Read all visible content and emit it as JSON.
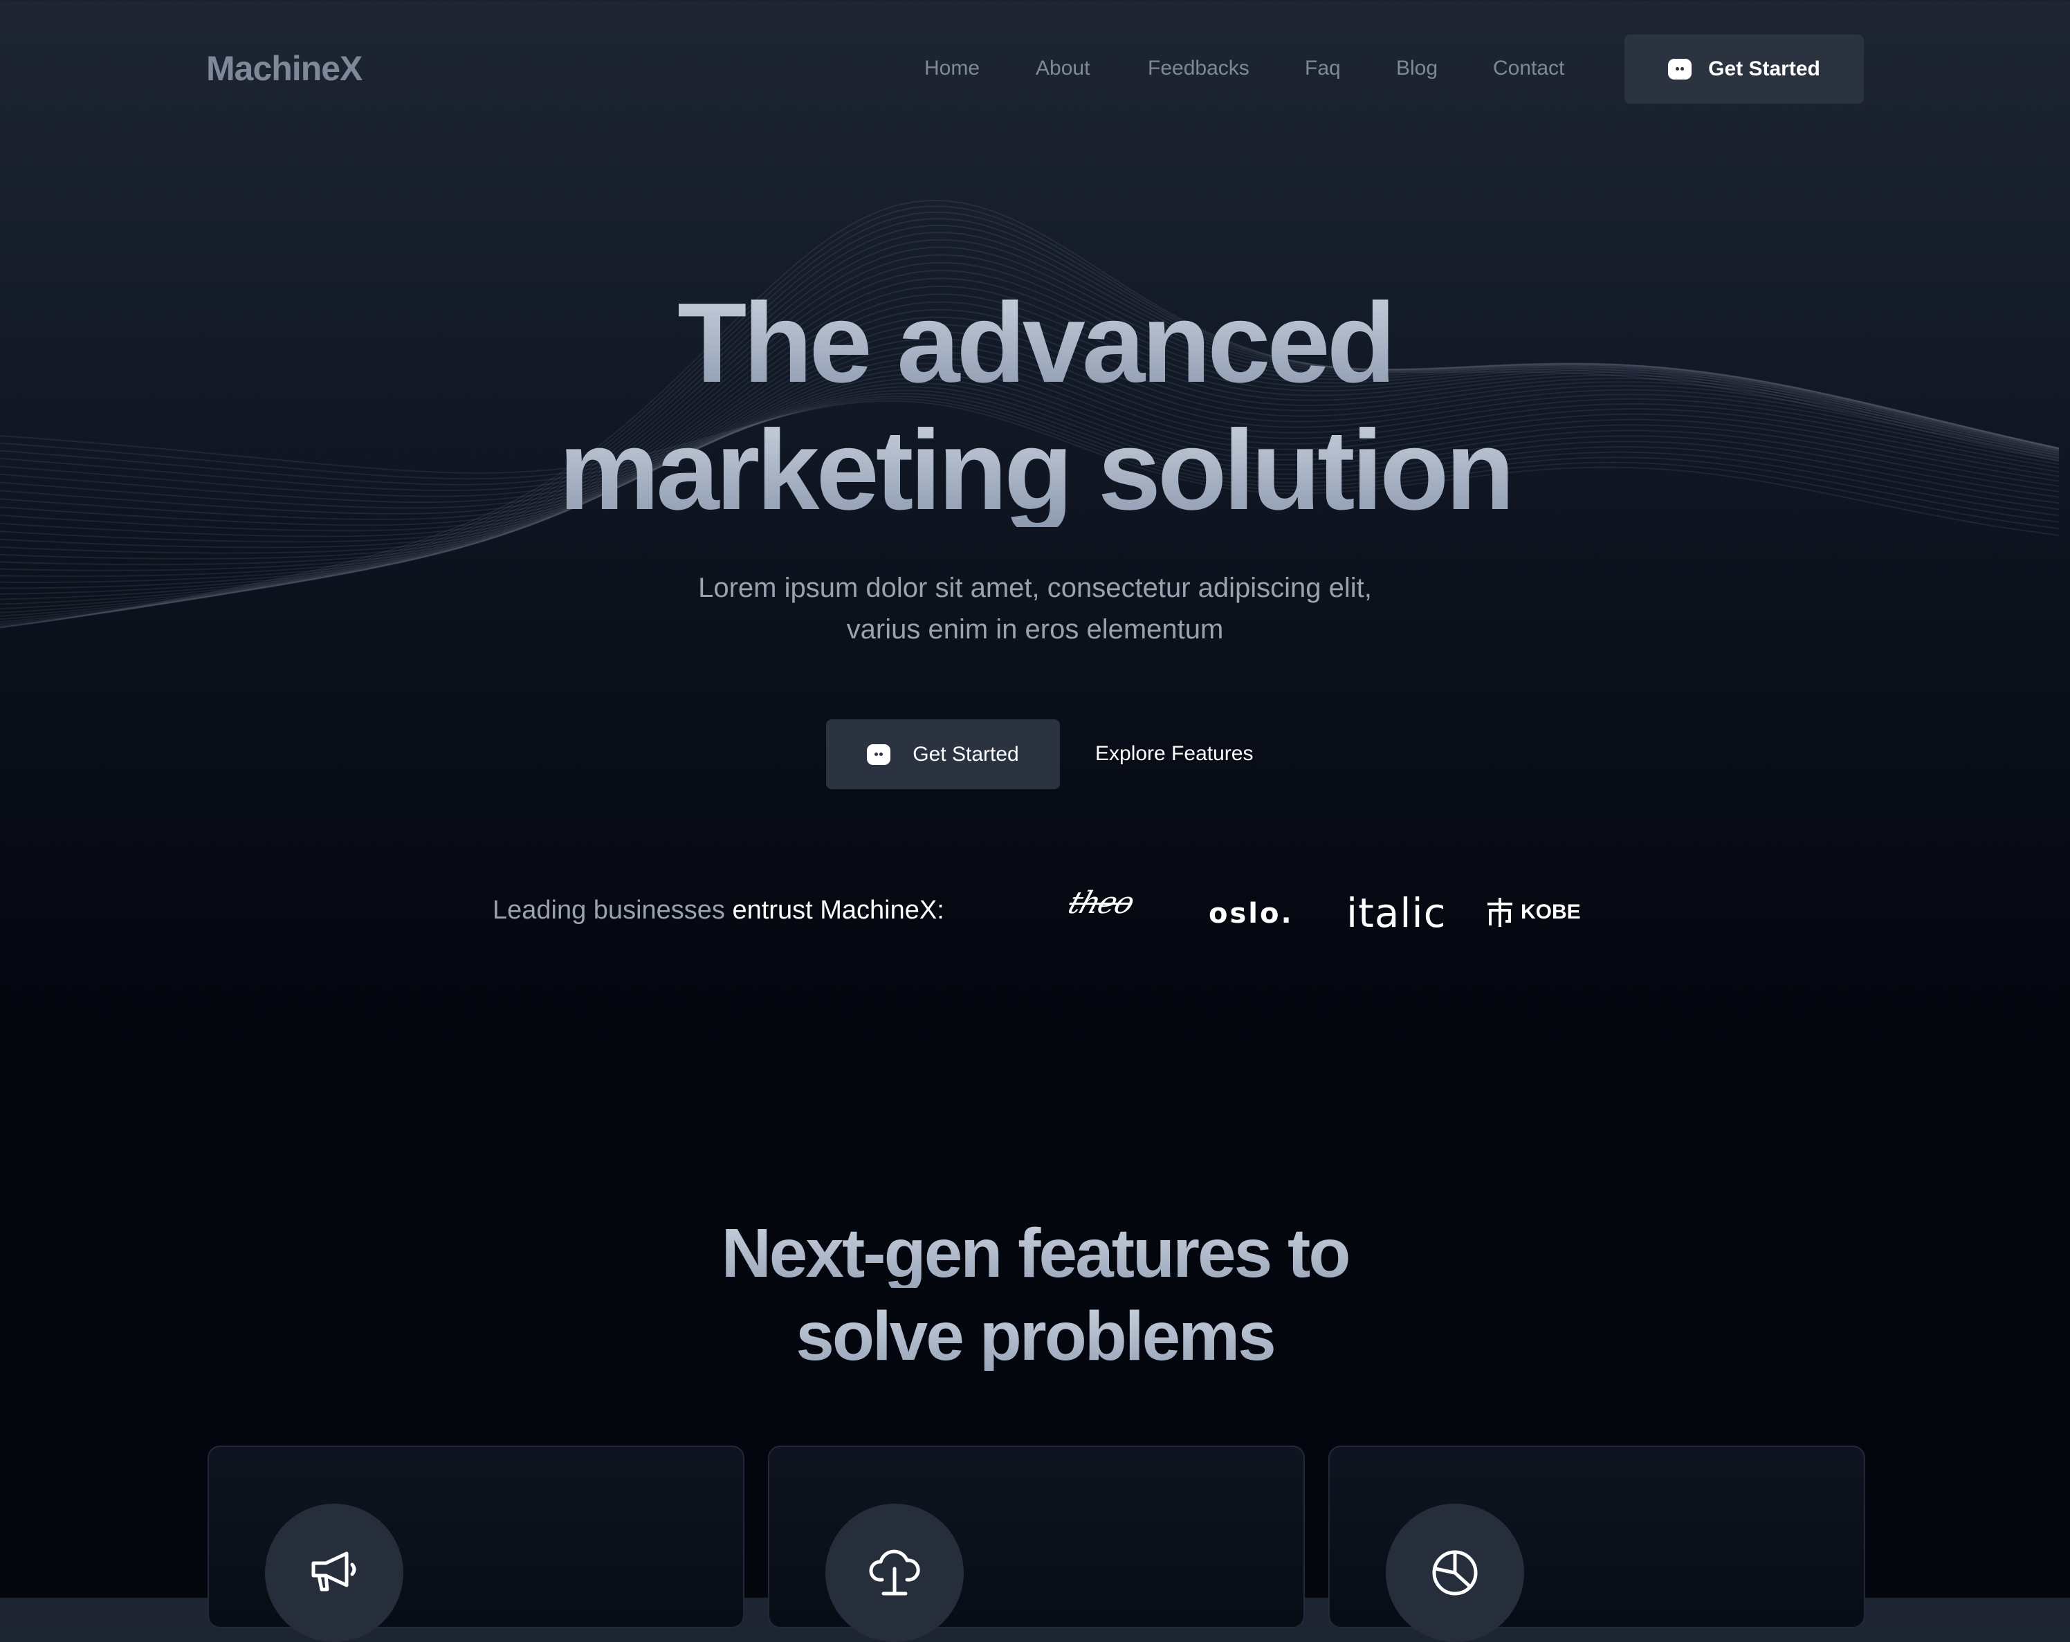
{
  "brand": "MachineX",
  "nav": {
    "items": [
      "Home",
      "About",
      "Feedbacks",
      "Faq",
      "Blog",
      "Contact"
    ],
    "cta_label": "Get Started"
  },
  "hero": {
    "title_line1": "The advanced",
    "title_line2": "marketing solution",
    "subtitle_line1": "Lorem ipsum dolor sit amet, consectetur adipiscing elit,",
    "subtitle_line2": "varius enim in eros elementum",
    "primary_cta": "Get Started",
    "secondary_cta": "Explore Features"
  },
  "trusted": {
    "lead": "Leading businesses",
    "emphasis": "entrust MachineX:",
    "logos": [
      "theo",
      "oslo.",
      "italic",
      "KOBE"
    ]
  },
  "features": {
    "title_line1": "Next-gen features to",
    "title_line2": "solve problems",
    "cards": [
      {
        "icon": "megaphone-icon"
      },
      {
        "icon": "cloud-upload-icon"
      },
      {
        "icon": "pie-chart-icon"
      }
    ]
  }
}
